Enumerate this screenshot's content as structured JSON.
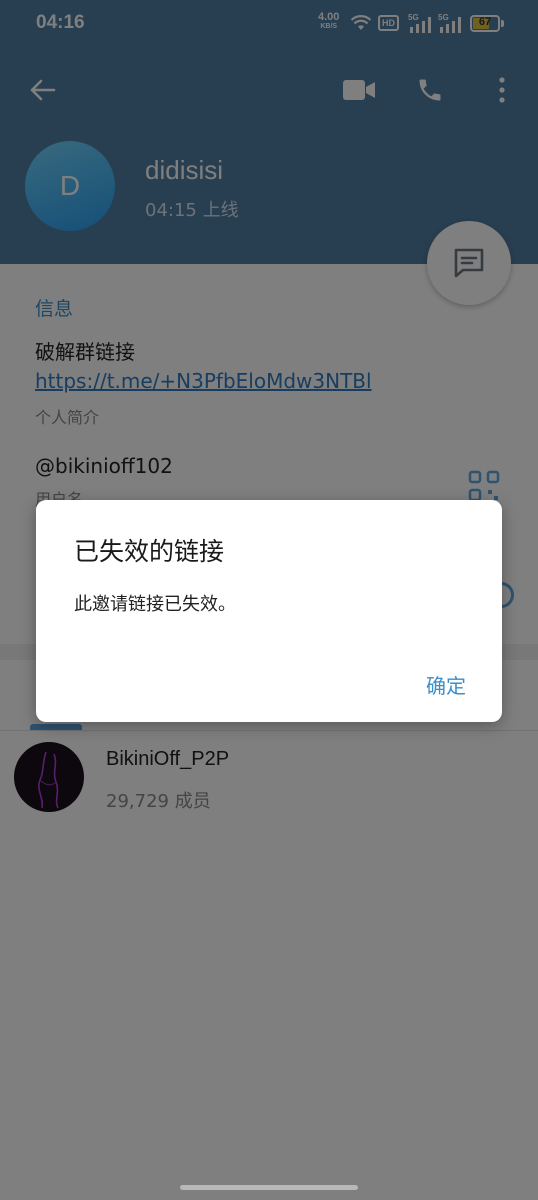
{
  "status_bar": {
    "time": "04:16",
    "net_speed": "4.00",
    "net_unit": "KB/S",
    "hd_label": "HD",
    "sim1_label": "5G",
    "sim2_label": "5G",
    "battery_level": 67,
    "battery_text": "67"
  },
  "header": {
    "avatar_letter": "D",
    "name": "didisisi",
    "status": "04:15 上线"
  },
  "info": {
    "section_title": "信息",
    "bio_text": "破解群链接 ",
    "bio_link": "https://t.me/+N3PfbEloMdw3NTBl",
    "bio_caption": "个人简介",
    "username": "@bikinioff102",
    "username_caption": "用户名"
  },
  "groups": [
    {
      "name": "BikiniOff_P2P",
      "members": "29,729 成员"
    }
  ],
  "dialog": {
    "title": "已失效的链接",
    "message": "此邀请链接已失效。",
    "ok_label": "确定"
  },
  "colors": {
    "header": "#517da2",
    "accent": "#3a8ecb",
    "battery": "#e0c341"
  }
}
